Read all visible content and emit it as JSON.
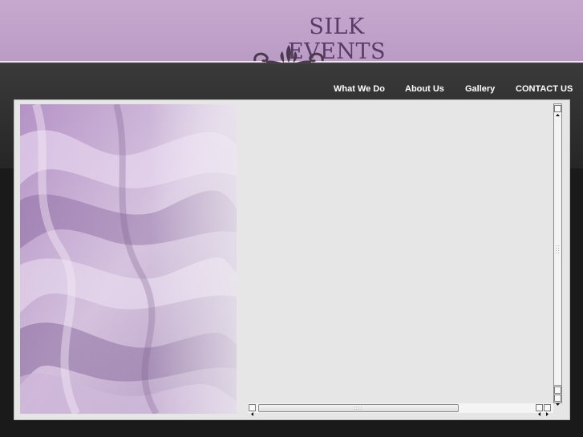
{
  "brand": {
    "title": "SILK EVENTS"
  },
  "nav": {
    "items": [
      {
        "label": "What We Do"
      },
      {
        "label": "About Us"
      },
      {
        "label": "Gallery"
      },
      {
        "label": "CONTACT US"
      }
    ]
  },
  "colors": {
    "header": "#c0a1cb",
    "brand_text": "#5a3a66",
    "background": "#1a1a1a",
    "panel": "#e6e6e6"
  },
  "icons": {
    "ornament": "flourish-ornament-icon",
    "scroll_up": "arrow-up-icon",
    "scroll_down": "arrow-down-icon",
    "scroll_left": "arrow-left-icon",
    "scroll_right": "arrow-right-icon"
  }
}
